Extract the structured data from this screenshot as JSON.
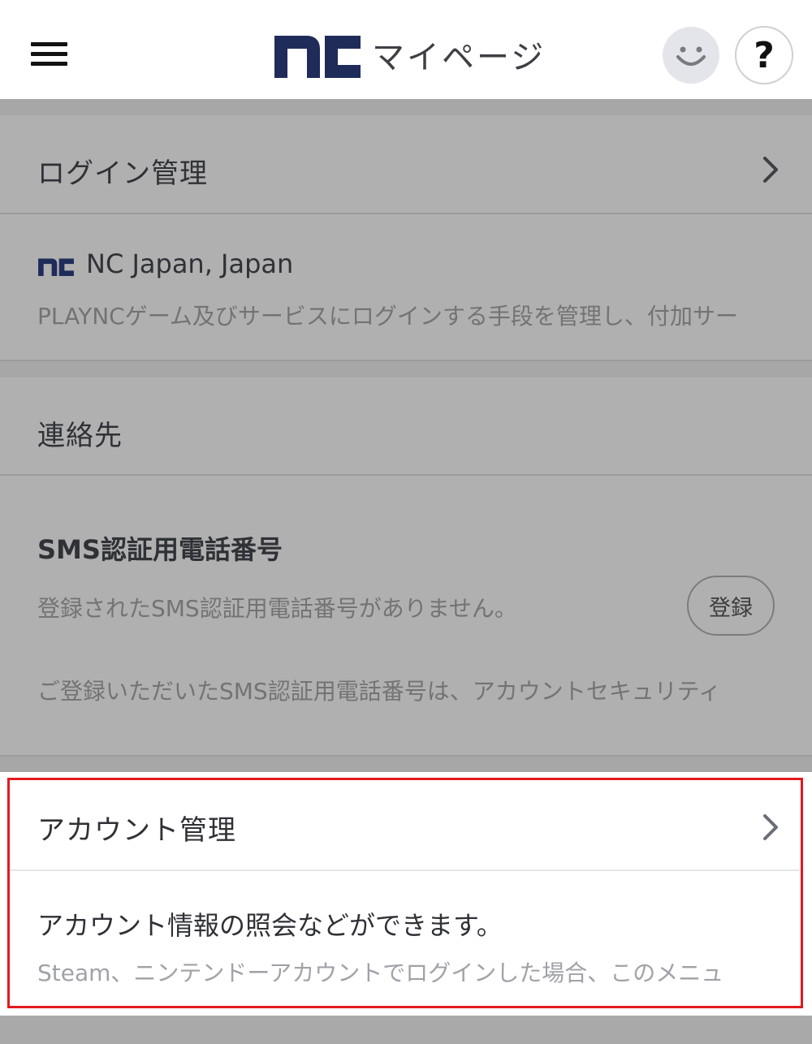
{
  "header": {
    "brand_logo": "nc",
    "title": "マイページ",
    "avatar_icon": "smiley-face-icon",
    "help_label": "?",
    "colors": {
      "brand": "#1f2c5a",
      "highlight": "#e3191f"
    }
  },
  "login_section": {
    "title": "ログイン管理",
    "account_name": "NC Japan, Japan",
    "description": "PLAYNCゲーム及びサービスにログインする手段を管理し、付加サー"
  },
  "contact_section": {
    "title": "連絡先",
    "sms_title": "SMS認証用電話番号",
    "sms_status": "登録されたSMS認証用電話番号がありません。",
    "register_button": "登録",
    "sms_note": "ご登録いただいたSMS認証用電話番号は、アカウントセキュリティ"
  },
  "account_section": {
    "title": "アカウント管理",
    "subtitle": "アカウント情報の照会などができます。",
    "note": "Steam、ニンテンドーアカウントでログインした場合、このメニュ"
  }
}
